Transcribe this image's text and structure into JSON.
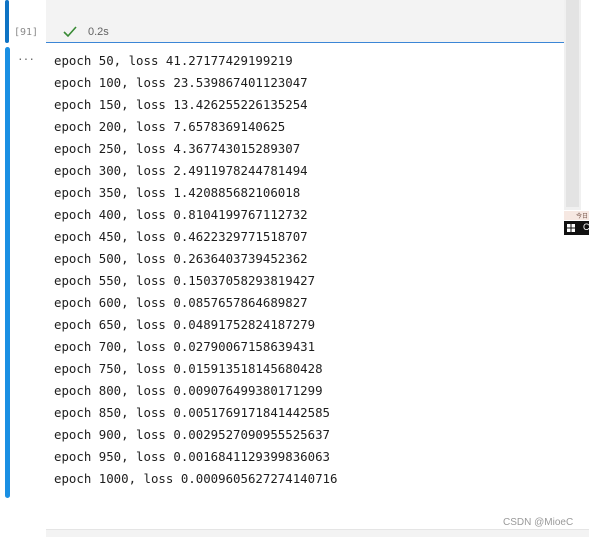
{
  "cell": {
    "execution_count": "[91]",
    "status_icon": "check-icon",
    "exec_time": "0.2s",
    "output_prompt": "···"
  },
  "output": {
    "lines": [
      "epoch 50, loss 41.27177429199219",
      "epoch 100, loss 23.539867401123047",
      "epoch 150, loss 13.426255226135254",
      "epoch 200, loss 7.6578369140625",
      "epoch 250, loss 4.367743015289307",
      "epoch 300, loss 2.4911978244781494",
      "epoch 350, loss 1.420885682106018",
      "epoch 400, loss 0.8104199767112732",
      "epoch 450, loss 0.4622329771518707",
      "epoch 500, loss 0.2636403739452362",
      "epoch 550, loss 0.15037058293819427",
      "epoch 600, loss 0.0857657864689827",
      "epoch 650, loss 0.04891752824187279",
      "epoch 700, loss 0.02790067158639431",
      "epoch 750, loss 0.015913518145680428",
      "epoch 800, loss 0.009076499380171299",
      "epoch 850, loss 0.0051769171841442585",
      "epoch 900, loss 0.0029527090955525637",
      "epoch 950, loss 0.0016841129399836063",
      "epoch 1000, loss 0.0009605627274140716"
    ]
  },
  "overlay": {
    "popup_text": "今日",
    "taskbar_text": "C",
    "windows_icon": "windows-logo-icon"
  },
  "watermark": "CSDN @MioeC",
  "colors": {
    "accent": "#1a8fe3",
    "success": "#388a34",
    "text": "#1e1e1e"
  }
}
